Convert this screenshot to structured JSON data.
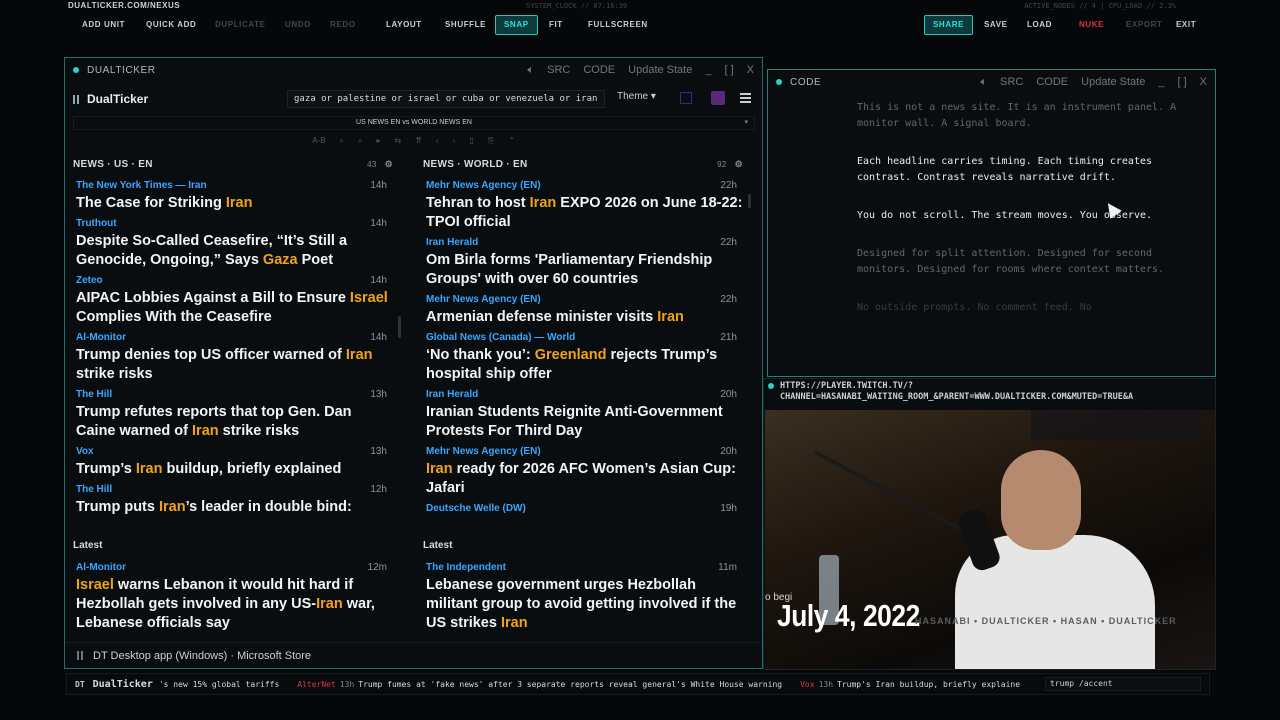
{
  "topbar": {
    "site_url": "DUALTICKER.COM/NEXUS",
    "system_clock": "SYSTEM_CLOCK // 07:16:39",
    "active_nodes": "ACTIVE_NODES // 4 | CPU_LOAD // 2.3%",
    "buttons": {
      "add_unit": "ADD UNIT",
      "quick_add": "QUICK ADD",
      "duplicate": "DUPLICATE",
      "undo": "UNDO",
      "redo": "REDO",
      "layout": "LAYOUT",
      "shuffle": "SHUFFLE",
      "snap": "SNAP",
      "fit": "FIT",
      "fullscreen": "FULLSCREEN",
      "share": "SHARE",
      "save": "SAVE",
      "load": "LOAD",
      "nuke": "NUKE",
      "export": "EXPORT",
      "exit": "EXIT"
    }
  },
  "main_panel": {
    "title": "DUALTICKER",
    "controls": {
      "src": "SRC",
      "code": "CODE",
      "update": "Update State",
      "min": "_",
      "max": "[ ]",
      "close": "X"
    },
    "app_name": "DualTicker",
    "search_value": "gaza or palestine or israel or cuba or venezuela or iran",
    "theme_label": "Theme ▾",
    "source_select": "US NEWS EN vs WORLD NEWS EN",
    "toolbar_glyphs": [
      "A-B",
      "⌕",
      "⌕",
      "▸",
      "⇆",
      "⇈",
      "‹",
      "›",
      "▯",
      "⎘",
      "⌃"
    ],
    "footer": "DT Desktop app (Windows) · Microsoft Store"
  },
  "columns": {
    "us": {
      "title": "NEWS · US · EN",
      "count": "43",
      "items": [
        {
          "source": "The New York Times — Iran",
          "age": "14h",
          "pre": "The Case for Striking ",
          "kw": "Iran",
          "post": ""
        },
        {
          "source": "Truthout",
          "age": "14h",
          "pre": "Despite So-Called Ceasefire, “It’s Still a Genocide, Ongoing,” Says ",
          "kw": "Gaza",
          "post": " Poet"
        },
        {
          "source": "Zeteo",
          "age": "14h",
          "pre": "AIPAC Lobbies Against a Bill to Ensure ",
          "kw": "Israel",
          "post": " Complies With the Ceasefire"
        },
        {
          "source": "Al-Monitor",
          "age": "14h",
          "pre": "Trump denies top US officer warned of ",
          "kw": "Iran",
          "post": " strike risks"
        },
        {
          "source": "The Hill",
          "age": "13h",
          "pre": "Trump refutes reports that top Gen. Dan Caine warned of ",
          "kw": "Iran",
          "post": " strike risks"
        },
        {
          "source": "Vox",
          "age": "13h",
          "pre": "Trump’s ",
          "kw": "Iran",
          "post": " buildup, briefly explained"
        },
        {
          "source": "The Hill",
          "age": "12h",
          "pre": "Trump puts ",
          "kw": "Iran",
          "post": "’s leader in double bind:"
        }
      ]
    },
    "world": {
      "title": "NEWS · WORLD · EN",
      "count": "92",
      "items": [
        {
          "source": "Mehr News Agency (EN)",
          "age": "22h",
          "pre": "Tehran to host ",
          "kw": "Iran",
          "post": " EXPO 2026 on June 18-22: TPOI official"
        },
        {
          "source": "Iran Herald",
          "age": "22h",
          "pre": "Om Birla forms 'Parliamentary Friendship Groups' with over 60 countries",
          "kw": "",
          "post": ""
        },
        {
          "source": "Mehr News Agency (EN)",
          "age": "22h",
          "pre": "Armenian defense minister visits ",
          "kw": "Iran",
          "post": ""
        },
        {
          "source": "Global News (Canada) — World",
          "age": "21h",
          "pre": "‘No thank you’: ",
          "kw": "Greenland",
          "post": " rejects Trump’s hospital ship offer"
        },
        {
          "source": "Iran Herald",
          "age": "20h",
          "pre": "Iranian Students Reignite Anti-Government Protests For Third Day",
          "kw": "",
          "post": ""
        },
        {
          "source": "Mehr News Agency (EN)",
          "age": "20h",
          "pre": "",
          "kw": "Iran",
          "post": " ready for 2026 AFC Women’s Asian Cup: Jafari"
        },
        {
          "source": "Deutsche Welle (DW)",
          "age": "19h",
          "pre": "",
          "kw": "",
          "post": ""
        }
      ]
    }
  },
  "latest": {
    "label": "Latest",
    "us": {
      "source": "Al-Monitor",
      "age": "12m",
      "pre": "",
      "kw1": "Israel",
      "mid": " warns Lebanon it would hit hard if Hezbollah gets involved in any US-",
      "kw2": "Iran",
      "post": " war, Lebanese officials say"
    },
    "world": {
      "source": "The Independent",
      "age": "11m",
      "pre": "Lebanese government urges Hezbollah militant group to avoid getting involved if the US strikes ",
      "kw": "Iran"
    }
  },
  "code_panel": {
    "title": "CODE",
    "controls": {
      "src": "SRC",
      "code": "CODE",
      "update": "Update State",
      "min": "_",
      "max": "[ ]",
      "close": "X"
    },
    "paragraphs": [
      {
        "text": "This is not a news site. It is an instrument panel. A monitor wall. A signal board.",
        "tone": "dim"
      },
      {
        "text": "Each headline carries timing. Each timing creates contrast. Contrast reveals narrative drift.",
        "tone": "bright"
      },
      {
        "text": "You do not scroll. The stream moves. You observe.",
        "tone": "bright"
      },
      {
        "text": "Designed for split attention. Designed for second monitors. Designed for rooms where context matters.",
        "tone": "dim"
      },
      {
        "text": "No outside prompts. No comment feed. No",
        "tone": "faint"
      }
    ]
  },
  "video_panel": {
    "url": "HTTPS://PLAYER.TWITCH.TV/?CHANNEL=HASANABI_WAITING_ROOM_&PARENT=WWW.DUALTICKER.COM&MUTED=TRUE&A",
    "date_overlay": "July 4, 2022",
    "caption": "o begi",
    "logo_strip": "HASANABI • DUALTICKER • HASAN • DUALTICKER"
  },
  "ticker": {
    "brand": "DT",
    "brand2": "DualTicker",
    "items": [
      {
        "source": "",
        "age": "",
        "text": "'s new 15% global tariffs",
        "kw": ""
      },
      {
        "source": "AlterNet",
        "age": "13h",
        "text": "Trump fumes at 'fake news' after 3 separate reports reveal general's White House warning",
        "kw": ""
      },
      {
        "source": "Vox",
        "age": "13h",
        "text": "Trump's Iran buildup, briefly explaine",
        "kw": ""
      }
    ],
    "input_value": "trump /accent"
  },
  "colors": {
    "accent": "#27d3c6",
    "keyword": "#f0a31a",
    "source": "#3aa6ff",
    "danger": "#d7334e"
  }
}
